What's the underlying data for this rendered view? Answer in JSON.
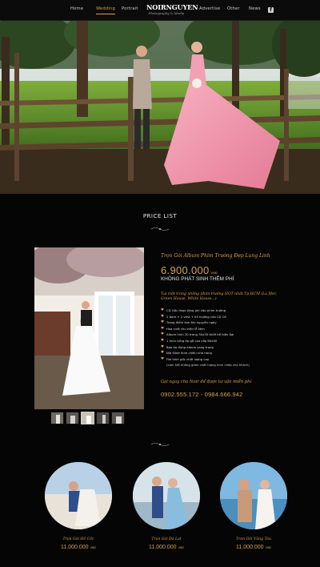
{
  "nav": {
    "items": [
      {
        "label": "Home",
        "active": false
      },
      {
        "label": "Wedding",
        "active": true
      },
      {
        "label": "Portrait",
        "active": false
      },
      {
        "label": "Advertise",
        "active": false
      },
      {
        "label": "Other",
        "active": false
      },
      {
        "label": "News",
        "active": false
      }
    ],
    "logo_main": "NOIRNGUYEN",
    "logo_sub": "Photography & Media",
    "social_icon": "facebook-icon"
  },
  "hero": {
    "alt": "couple-in-forest-photo"
  },
  "price_list": {
    "title": "PRICE LIST",
    "package_name": "Trọn Gói Album Phim Trường Đẹp Lung Linh",
    "price": "6.900.000",
    "currency": "VNĐ",
    "no_extra_fee": "KHÔNG PHÁT SINH THÊM PHÍ",
    "locations": "Tại một trong những phim trường HOT nhất Tp.HCM (La Mer, Green House, White House...)",
    "features": [
      "CD Gốc được tặng phí vào phim trường",
      "2 bore + 2 vest + 05 trường của CD CK",
      "Trang điểm làm tóc nguyên ngày",
      "Hoa cưới chu kiện lễ kèm",
      "Album hình 30 trang 30x30 thiết kế hiện đại",
      "1 hình cổng ép gỗ cao cấp 60x90",
      "Bao da đựng album sang trọng",
      "Đĩa Slide hình chiều nhà hàng",
      "File hình gốc chất lượng cao"
    ],
    "note": "(cam kết không giảm chất lượng hình chép cho khách)",
    "cta": "Gọi ngay cho Noir để được tư vấn miễn phí",
    "phones": "0902.555.172  -  0984.666.942",
    "thumb_count": 5,
    "active_thumb": 2
  },
  "packages": [
    {
      "title": "Trọn Gói Hồ Cốc",
      "price": "11.000.000",
      "currency": "VNĐ"
    },
    {
      "title": "Trọn Gói Đà Lạt",
      "price": "11.000.000",
      "currency": "VNĐ"
    },
    {
      "title": "Trọn Gói Vũng Tàu",
      "price": "11.000.000",
      "currency": "VNĐ"
    }
  ],
  "colors": {
    "accent": "#d4a24d",
    "background": "#050505"
  }
}
